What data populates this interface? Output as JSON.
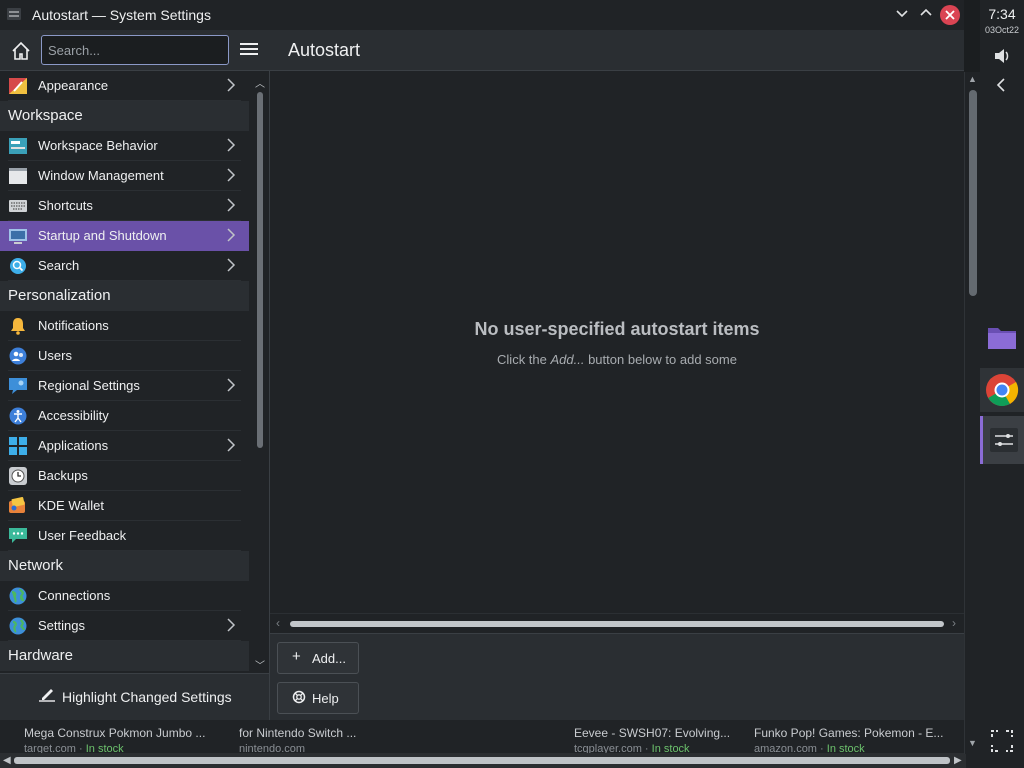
{
  "window": {
    "title": "Autostart — System Settings",
    "close_color": "#da4453"
  },
  "system_panel": {
    "time": "7:34",
    "date": "03Oct22",
    "icons": [
      "volume-icon",
      "collapse-chevron-icon",
      "folder-icon",
      "chrome-icon",
      "system-settings-icon",
      "expand-icon"
    ]
  },
  "sidebar": {
    "search_placeholder": "Search...",
    "items": [
      {
        "type": "item",
        "label": "Appearance",
        "icon": "appearance-icon",
        "chevron": true
      },
      {
        "type": "header",
        "label": "Workspace"
      },
      {
        "type": "item",
        "label": "Workspace Behavior",
        "icon": "workspace-behavior-icon",
        "chevron": true
      },
      {
        "type": "item",
        "label": "Window Management",
        "icon": "window-management-icon",
        "chevron": true
      },
      {
        "type": "item",
        "label": "Shortcuts",
        "icon": "keyboard-icon",
        "chevron": true
      },
      {
        "type": "item",
        "label": "Startup and Shutdown",
        "icon": "startup-icon",
        "chevron": true,
        "selected": true
      },
      {
        "type": "item",
        "label": "Search",
        "icon": "search-icon",
        "chevron": true
      },
      {
        "type": "header",
        "label": "Personalization"
      },
      {
        "type": "item",
        "label": "Notifications",
        "icon": "bell-icon",
        "chevron": false
      },
      {
        "type": "item",
        "label": "Users",
        "icon": "users-icon",
        "chevron": false
      },
      {
        "type": "item",
        "label": "Regional Settings",
        "icon": "regional-icon",
        "chevron": true
      },
      {
        "type": "item",
        "label": "Accessibility",
        "icon": "accessibility-icon",
        "chevron": false
      },
      {
        "type": "item",
        "label": "Applications",
        "icon": "applications-icon",
        "chevron": true
      },
      {
        "type": "item",
        "label": "Backups",
        "icon": "backups-icon",
        "chevron": false
      },
      {
        "type": "item",
        "label": "KDE Wallet",
        "icon": "wallet-icon",
        "chevron": false
      },
      {
        "type": "item",
        "label": "User Feedback",
        "icon": "feedback-icon",
        "chevron": false
      },
      {
        "type": "header",
        "label": "Network"
      },
      {
        "type": "item",
        "label": "Connections",
        "icon": "globe-icon",
        "chevron": false
      },
      {
        "type": "item",
        "label": "Settings",
        "icon": "network-settings-icon",
        "chevron": true
      },
      {
        "type": "header",
        "label": "Hardware"
      }
    ],
    "footer_button": "Highlight Changed Settings",
    "selected_color": "#6a51a8"
  },
  "content": {
    "title": "Autostart",
    "empty_title": "No user-specified autostart items",
    "empty_hint_before": "Click the ",
    "empty_hint_em": "Add...",
    "empty_hint_after": " button below to add some",
    "add_button": "Add...",
    "help_button": "Help"
  },
  "background_page": {
    "items": [
      {
        "title": "Mega Construx Pokmon Jumbo ...",
        "source": "target.com",
        "stock": "In stock"
      },
      {
        "title": "for Nintendo Switch ...",
        "source": "nintendo.com",
        "stock": ""
      },
      {
        "title": "Eevee - SWSH07: Evolving...",
        "source": "tcgplayer.com",
        "stock": "In stock"
      },
      {
        "title": "Funko Pop! Games: Pokemon - E...",
        "source": "amazon.com",
        "stock": "In stock"
      }
    ]
  }
}
